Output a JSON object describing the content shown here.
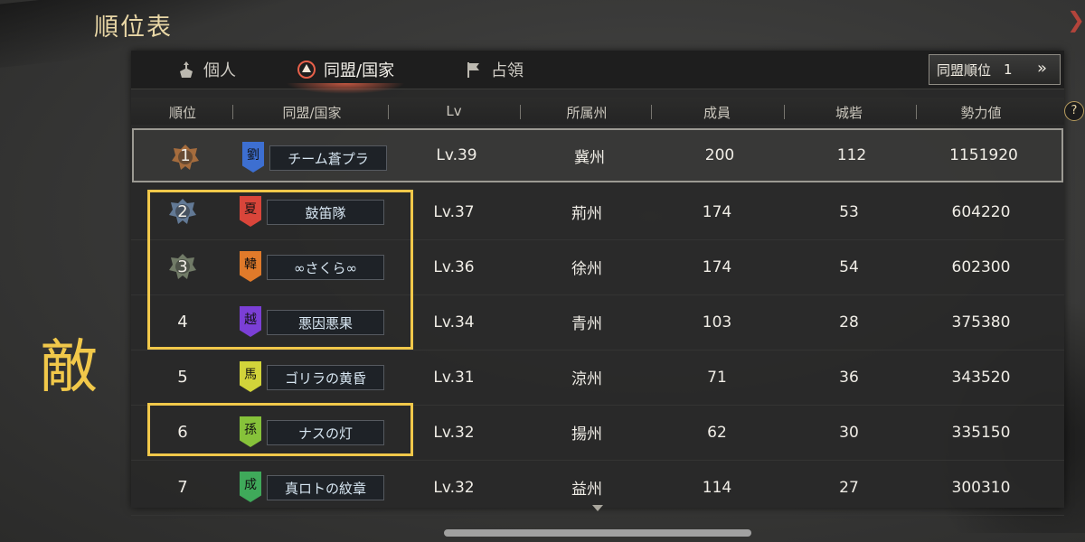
{
  "window": {
    "title": "順位表"
  },
  "tabs": [
    {
      "label": "個人",
      "icon": "person-banner-icon",
      "active": false
    },
    {
      "label": "同盟/国家",
      "icon": "alliance-crest-icon",
      "active": true
    },
    {
      "label": "占領",
      "icon": "flag-icon",
      "active": false
    }
  ],
  "alliance_rank": {
    "label": "同盟順位",
    "value": "1",
    "chevron": "»"
  },
  "table": {
    "headers": {
      "rank": "順位",
      "alliance": "同盟/国家",
      "lv": "Lv",
      "province": "所属州",
      "members": "成員",
      "castles": "城砦",
      "power": "勢力値"
    },
    "help": "?",
    "rows": [
      {
        "rank": "1",
        "emblem": "劉",
        "emblem_color": "#3d6fd1",
        "name": "チーム蒼プラ",
        "lv": "Lv.39",
        "province": "冀州",
        "members": "200",
        "castles": "112",
        "power": "1151920",
        "medal": "bronze",
        "mine": true
      },
      {
        "rank": "2",
        "emblem": "夏",
        "emblem_color": "#d9453a",
        "name": "鼓笛隊",
        "lv": "Lv.37",
        "province": "荊州",
        "members": "174",
        "castles": "53",
        "power": "604220",
        "medal": "silver"
      },
      {
        "rank": "3",
        "emblem": "韓",
        "emblem_color": "#e07a2a",
        "name": "∞さくら∞",
        "lv": "Lv.36",
        "province": "徐州",
        "members": "174",
        "castles": "54",
        "power": "602300",
        "medal": "green"
      },
      {
        "rank": "4",
        "emblem": "越",
        "emblem_color": "#7b3fd6",
        "name": "悪因悪果",
        "lv": "Lv.34",
        "province": "青州",
        "members": "103",
        "castles": "28",
        "power": "375380"
      },
      {
        "rank": "5",
        "emblem": "馬",
        "emblem_color": "#d2d43a",
        "name": "ゴリラの黄昏",
        "lv": "Lv.31",
        "province": "涼州",
        "members": "71",
        "castles": "36",
        "power": "343520"
      },
      {
        "rank": "6",
        "emblem": "孫",
        "emblem_color": "#86c23a",
        "name": "ナスの灯",
        "lv": "Lv.32",
        "province": "揚州",
        "members": "62",
        "castles": "30",
        "power": "335150"
      },
      {
        "rank": "7",
        "emblem": "成",
        "emblem_color": "#3fa95a",
        "name": "真ロトの紋章",
        "lv": "Lv.32",
        "province": "益州",
        "members": "114",
        "castles": "27",
        "power": "300310"
      }
    ]
  },
  "annotation": {
    "text": "敵",
    "color": "#f1c84a"
  }
}
